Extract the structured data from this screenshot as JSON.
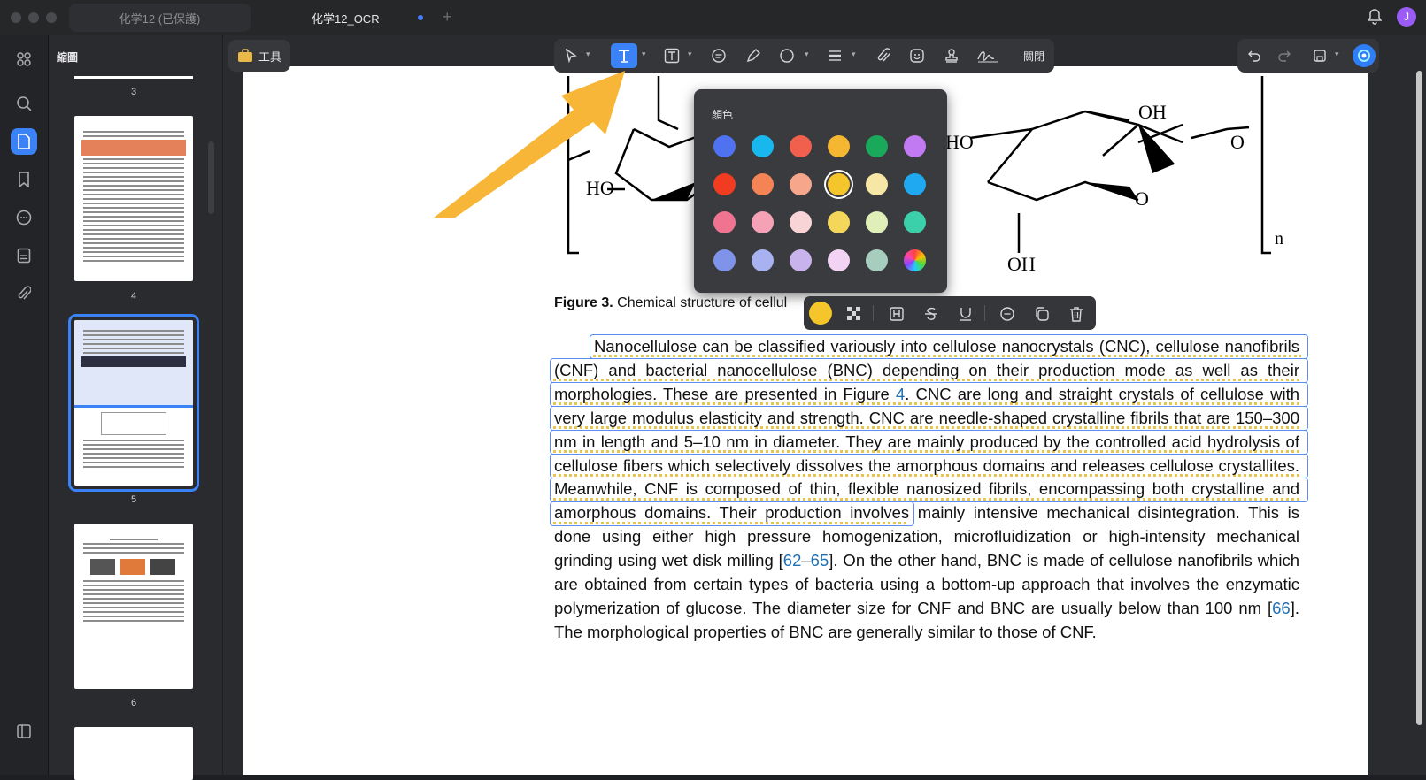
{
  "window": {
    "tabs": [
      {
        "label": "化学12 (已保護)",
        "active": false
      },
      {
        "label": "化学12_OCR",
        "active": true
      }
    ],
    "new_tab_symbol": "+",
    "avatar_letter": "J"
  },
  "sidebar": {
    "title": "縮圖",
    "pages": [
      "3",
      "4",
      "5",
      "6"
    ],
    "selected_page": "5"
  },
  "tools_button": {
    "label": "工具"
  },
  "toolbar": {
    "close_label": "關閉",
    "active_tool": "text-tool"
  },
  "color_popover": {
    "title": "顏色",
    "colors": [
      "#4f72f0",
      "#18b8ef",
      "#f0604d",
      "#f5b731",
      "#1aa85b",
      "#c27af2",
      "#f23c22",
      "#f48456",
      "#f6a68a",
      "#f5c52c",
      "#f7e7a6",
      "#1fa9f1",
      "#f07490",
      "#f5a2b6",
      "#f8d4d6",
      "#f3d65a",
      "#dfefb7",
      "#3cd0aa",
      "#7f93e8",
      "#a8b2f0",
      "#c9b3ec",
      "#f2d3f3",
      "#a6cdbd",
      "#rainbow"
    ],
    "selected_index": 9
  },
  "document": {
    "caption_label": "Figure 3.",
    "caption_text": " Chemical structure of cellul",
    "chem_labels": {
      "ho_left": "HO",
      "ho_mid": "HO",
      "oh_top": "OH",
      "oh_bottom": "OH",
      "o_ring": "O",
      "o_link": "O",
      "n": "n"
    },
    "p1": "Nanocellulose can be classified variously into cellulose nanocrystals (CNC), cellulose nanofibrils (CNF) and bacterial nanocellulose (BNC) depending on their production mode as well as their morphologies. These are presented in Figure ",
    "ref_fig": "4",
    "p2": ". CNC are long and straight crystals of cellulose with very large modulus elasticity and strength. CNC are needle-shaped crystalline fibrils that are 150–300 nm in length and 5–10 nm in diameter. They are mainly produced by the controlled acid hydrolysis of cellulose fibers which selectively dissolves the amorphous domains and releases cellulose crystallites. Meanwhile, CNF is composed of thin, flexible nanosized fibrils, encompassing both crystalline and amorphous domains. Their production involves mainly intensive mechanical disintegration. This is done using either high pressure homogenization, microfluidization or high-intensity mechanical grinding using wet disk milling [",
    "ref1": "62",
    "dash": "–",
    "ref2": "65",
    "p3": "]. On the other hand, BNC is made of cellulose nanofibrils which are obtained from certain types of bacteria using a bottom-up approach that involves the enzymatic polymerization of glucose. The diameter size for CNF and BNC are usually below than 100 nm [",
    "ref3": "66",
    "p4": "]. The morphological properties of BNC are generally similar to those of CNF."
  },
  "colors": {
    "accent": "#3b82f6",
    "highlight": "#f5c52c"
  }
}
